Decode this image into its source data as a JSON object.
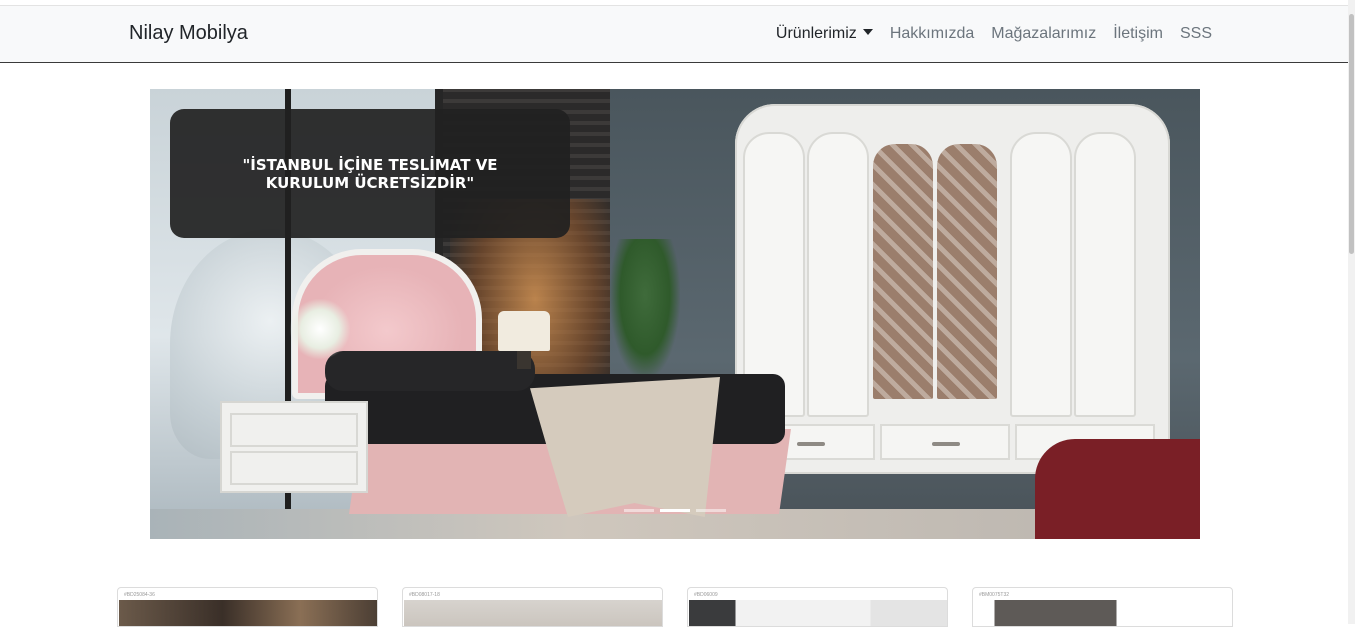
{
  "navbar": {
    "brand": "Nilay Mobilya",
    "links": [
      {
        "label": "Ürünlerimiz",
        "active": true,
        "dropdown": true
      },
      {
        "label": "Hakkımızda"
      },
      {
        "label": "Mağazalarımız"
      },
      {
        "label": "İletişim"
      },
      {
        "label": "SSS"
      }
    ]
  },
  "carousel": {
    "caption": "\"İSTANBUL İÇİNE TESLİMAT VE KURULUM ÜCRETSİZDİR\"",
    "active_slide": 2,
    "slide_count": 3
  },
  "cards": [
    {
      "code": "#BD25084-36"
    },
    {
      "code": "#BD08017-18"
    },
    {
      "code": "#BD06009"
    },
    {
      "code": "#BM0075T32"
    }
  ],
  "colors": {
    "navbar_bg": "#f8f9fa",
    "caption_bg": "#212121",
    "text_dark": "#212529",
    "text_muted": "#6c757d"
  }
}
